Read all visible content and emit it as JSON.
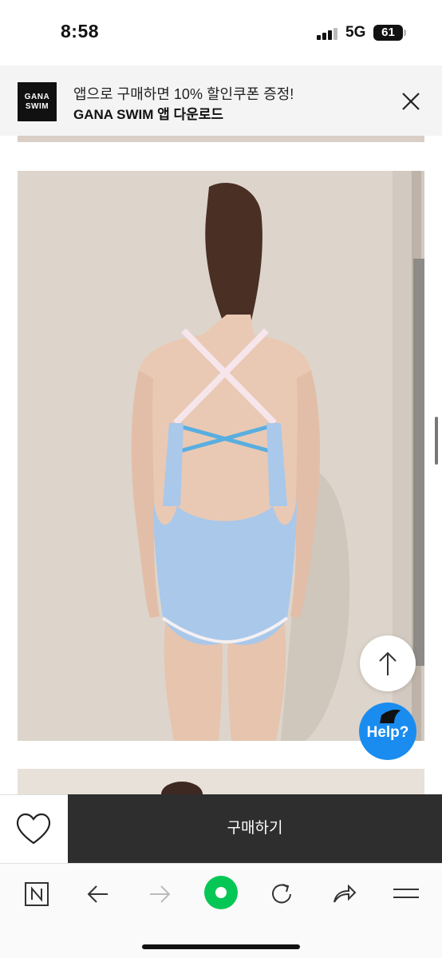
{
  "status_bar": {
    "time": "8:58",
    "network": "5G",
    "battery": "61"
  },
  "app_banner": {
    "logo_line1": "GANA",
    "logo_line2": "SWIM",
    "promo_text": "앱으로 구매하면 10% 할인쿠폰 증정!",
    "download_text": "GANA SWIM 앱 다운로드",
    "close_icon": "close-icon"
  },
  "floating": {
    "top_icon": "arrow-up-icon",
    "help_label": "Help?"
  },
  "purchase_bar": {
    "buy_label": "구매하기",
    "wish_icon": "heart-icon"
  },
  "browser_toolbar": {
    "icons": [
      "naver-home-icon",
      "back-arrow-icon",
      "forward-arrow-icon",
      "green-dot-icon",
      "reload-icon",
      "share-icon",
      "menu-icon"
    ]
  },
  "colors": {
    "buy_bar": "#2e2e2e",
    "help": "#1a8cf0",
    "green_button": "#06c755",
    "swimsuit": "#a9c8ea",
    "strap_blue": "#59aee0"
  }
}
